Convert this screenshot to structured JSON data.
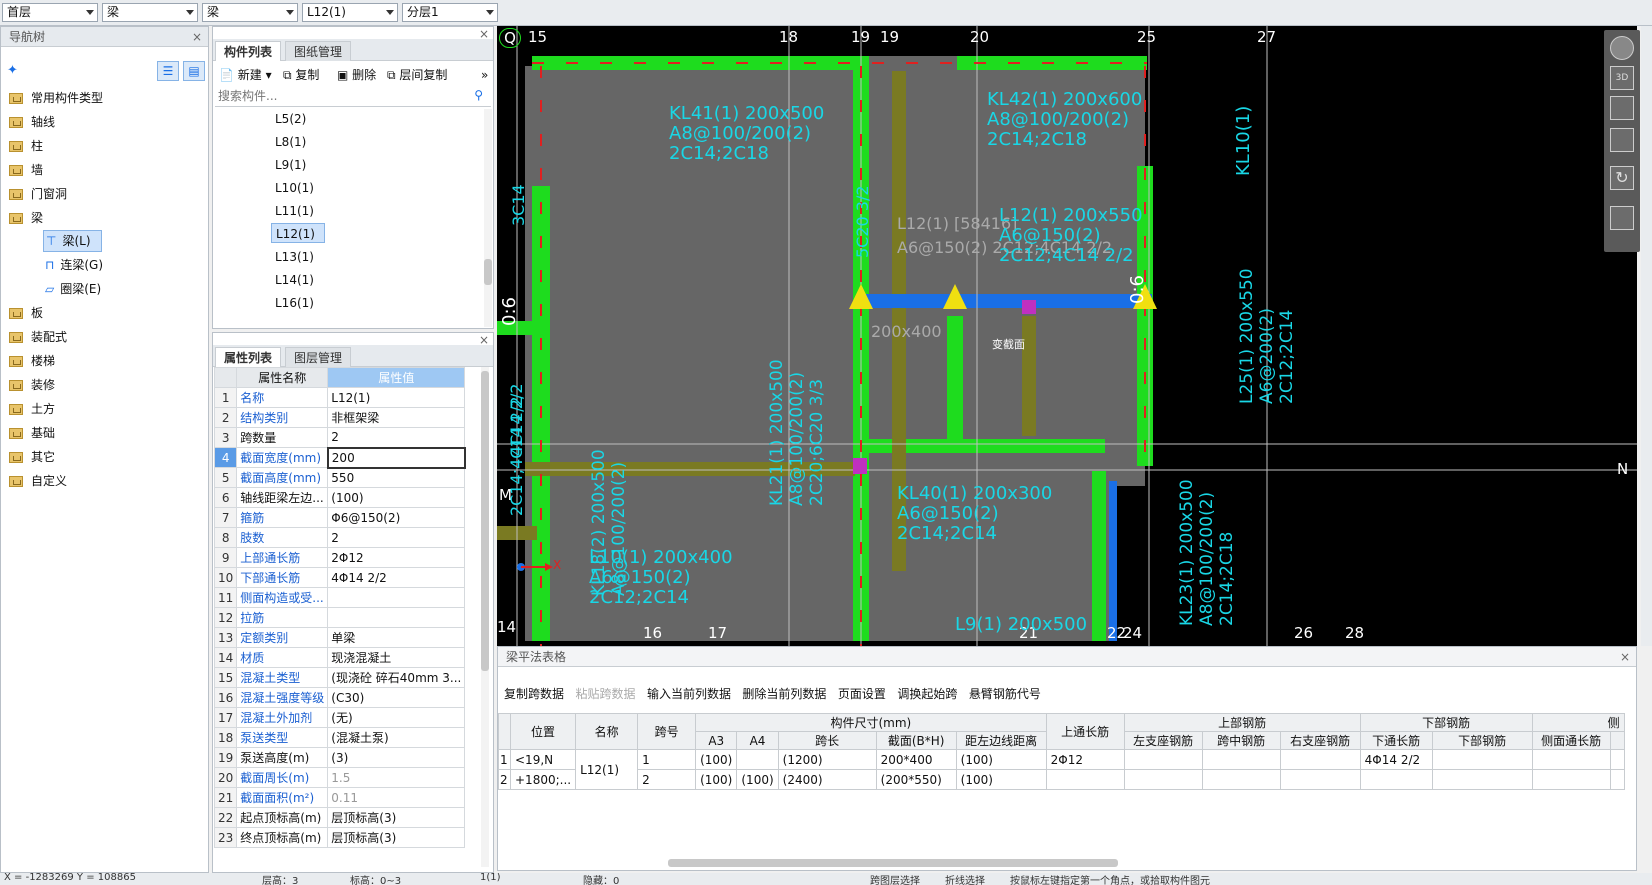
{
  "topbar": {
    "combos": [
      "首层",
      "梁",
      "梁",
      "L12(1)",
      "分层1"
    ]
  },
  "navtree": {
    "title": "导航树",
    "items": [
      "常用构件类型",
      "轴线",
      "柱",
      "墙",
      "门窗洞",
      "梁",
      "板",
      "装配式",
      "楼梯",
      "装修",
      "土方",
      "基础",
      "其它",
      "自定义"
    ],
    "children": [
      "梁(L)",
      "连梁(G)",
      "圈梁(E)"
    ]
  },
  "component_list": {
    "tabs": [
      "构件列表",
      "图纸管理"
    ],
    "tools": [
      "新建",
      "复制",
      "删除",
      "层间复制"
    ],
    "search_placeholder": "搜索构件...",
    "items": [
      "L5(2)",
      "L8(1)",
      "L9(1)",
      "L10(1)",
      "L11(1)",
      "L12(1)",
      "L13(1)",
      "L14(1)",
      "L16(1)"
    ]
  },
  "props": {
    "tabs": [
      "属性列表",
      "图层管理"
    ],
    "header": [
      "属性名称",
      "属性值"
    ],
    "rows": [
      {
        "n": "1",
        "k": "名称",
        "v": "L12(1)"
      },
      {
        "n": "2",
        "k": "结构类别",
        "v": "非框架梁"
      },
      {
        "n": "3",
        "k": "跨数量",
        "v": "2"
      },
      {
        "n": "4",
        "k": "截面宽度(mm)",
        "v": "200"
      },
      {
        "n": "5",
        "k": "截面高度(mm)",
        "v": "550"
      },
      {
        "n": "6",
        "k": "轴线距梁左边...",
        "v": "(100)"
      },
      {
        "n": "7",
        "k": "箍筋",
        "v": "Φ6@150(2)"
      },
      {
        "n": "8",
        "k": "肢数",
        "v": "2"
      },
      {
        "n": "9",
        "k": "上部通长筋",
        "v": "2Φ12"
      },
      {
        "n": "10",
        "k": "下部通长筋",
        "v": "4Φ14 2/2"
      },
      {
        "n": "11",
        "k": "侧面构造或受...",
        "v": ""
      },
      {
        "n": "12",
        "k": "拉筋",
        "v": ""
      },
      {
        "n": "13",
        "k": "定额类别",
        "v": "单梁"
      },
      {
        "n": "14",
        "k": "材质",
        "v": "现浇混凝土"
      },
      {
        "n": "15",
        "k": "混凝土类型",
        "v": "(现浇砼 碎石40mm 3..."
      },
      {
        "n": "16",
        "k": "混凝土强度等级",
        "v": "(C30)"
      },
      {
        "n": "17",
        "k": "混凝土外加剂",
        "v": "(无)"
      },
      {
        "n": "18",
        "k": "泵送类型",
        "v": "(混凝土泵)"
      },
      {
        "n": "19",
        "k": "泵送高度(m)",
        "v": "(3)"
      },
      {
        "n": "20",
        "k": "截面周长(m)",
        "v": "1.5"
      },
      {
        "n": "21",
        "k": "截面面积(m²)",
        "v": "0.11"
      },
      {
        "n": "22",
        "k": "起点顶标高(m)",
        "v": "层顶标高(3)"
      },
      {
        "n": "23",
        "k": "终点顶标高(m)",
        "v": "层顶标高(3)"
      }
    ]
  },
  "canvas": {
    "axis_labels": [
      "Q",
      "15",
      "18",
      "19",
      "19",
      "20",
      "25",
      "27",
      "M",
      "N",
      "14",
      "16",
      "17",
      "21",
      "22",
      "24",
      "26",
      "28"
    ],
    "beam_texts": [
      "KL41(1) 200x500",
      "A8@100/200(2)",
      "2C14;2C18",
      "KL42(1) 200x600",
      "A8@100/200(2)",
      "2C14;2C18",
      "L12(1) [58416]",
      "A6@150(2) 2C12;4C14 2/2",
      "L12(1) 200x550",
      "A6@150(2)",
      "2C12;4C14 2/2",
      "KL10(1)",
      "3C14",
      "5C20 3/2",
      "0:6",
      "0:6",
      "2C14;4C14 2/2",
      "KL18(2) 200x500",
      "A8@100/200(2)",
      "KL21(1) 200x500",
      "A8@100/200(2)",
      "2C20;6C20 3/3",
      "KL40(1) 200x300",
      "A6@150(2)",
      "2C14;2C14",
      "L10(1) 200x400",
      "A6@150(2)",
      "2C12;2C14",
      "L25(1) 200x550",
      "A6@200(2)",
      "2C12;2C14",
      "KL23(1) 200x500",
      "A8@100/200(2)",
      "2C14;2C18",
      "L9(1) 200x500",
      "200x400",
      "4C14 2/2",
      "变截面",
      "X"
    ]
  },
  "beam_table": {
    "title": "梁平法表格",
    "tools": [
      "复制跨数据",
      "粘贴跨数据",
      "输入当前列数据",
      "删除当前列数据",
      "页面设置",
      "调换起始跨",
      "悬臂钢筋代号"
    ],
    "h1": [
      "位置",
      "名称",
      "跨号",
      "构件尺寸(mm)",
      "上通长筋",
      "上部钢筋",
      "下部钢筋",
      "侧"
    ],
    "h2": [
      "A3",
      "A4",
      "跨长",
      "截面(B*H)",
      "距左边线距离",
      "左支座钢筋",
      "跨中钢筋",
      "右支座钢筋",
      "下通长筋",
      "下部钢筋",
      "侧面通长筋"
    ],
    "rows": [
      {
        "i": "1",
        "pos": "<19,N",
        "name": "L12(1)",
        "span": "1",
        "a3": "(100)",
        "a4": "",
        "len": "(1200)",
        "sec": "200*400",
        "dist": "(100)",
        "top": "2Φ12",
        "bot": "4Φ14 2/2"
      },
      {
        "i": "2",
        "pos": "+1800;...",
        "name": "",
        "span": "2",
        "a3": "(100)",
        "a4": "(100)",
        "len": "(2400)",
        "sec": "(200*550)",
        "dist": "(100)",
        "top": "",
        "bot": ""
      }
    ]
  },
  "status": {
    "items": [
      "X = -1283269  Y = 108865",
      "层高：3",
      "标高：0~3",
      "1(1)",
      "隐藏：0",
      "跨图层选择",
      "折线选择",
      "按鼠标左键指定第一个角点，或拾取构件图元"
    ]
  },
  "colors": {
    "beam_green": "#1edc1e",
    "axis_cyan": "#19d7e6",
    "bg_black": "#000000",
    "select_blue": "#1a6fe6"
  }
}
